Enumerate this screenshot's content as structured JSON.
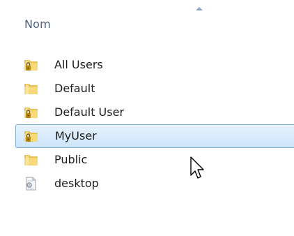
{
  "explorer": {
    "column_header": {
      "label": "Nom",
      "sort_direction": "ascending"
    },
    "items": [
      {
        "name": "All Users",
        "icon": "locked-folder-icon",
        "selected": false
      },
      {
        "name": "Default",
        "icon": "folder-icon",
        "selected": false
      },
      {
        "name": "Default User",
        "icon": "locked-folder-icon",
        "selected": false
      },
      {
        "name": "MyUser",
        "icon": "locked-folder-icon",
        "selected": true
      },
      {
        "name": "Public",
        "icon": "folder-icon",
        "selected": false
      },
      {
        "name": "desktop",
        "icon": "settings-file-icon",
        "selected": false
      }
    ]
  },
  "colors": {
    "header_text": "#4c6083",
    "selection_fill": "#cde5fb",
    "selection_border": "#84acdd",
    "folder": "#f5d46c",
    "lock": "#c9a227"
  }
}
